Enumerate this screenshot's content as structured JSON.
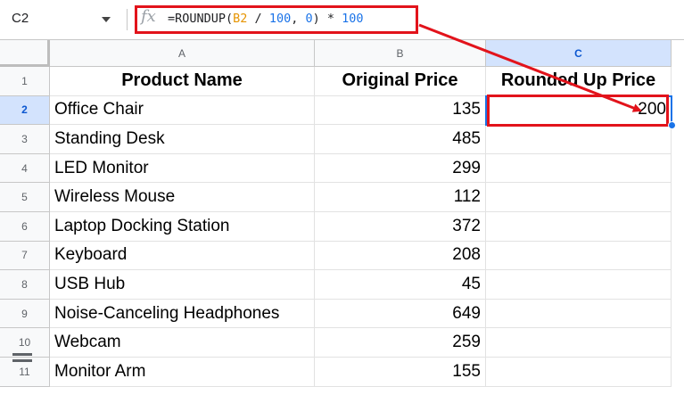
{
  "formula_bar": {
    "name_box": "C2",
    "fx_icon": "fx-icon",
    "formula_parts": [
      {
        "text": "=ROUNDUP(",
        "kind": "func"
      },
      {
        "text": "B2",
        "kind": "ref"
      },
      {
        "text": " / ",
        "kind": "func"
      },
      {
        "text": "100",
        "kind": "num"
      },
      {
        "text": ", ",
        "kind": "func"
      },
      {
        "text": "0",
        "kind": "num"
      },
      {
        "text": ") * ",
        "kind": "func"
      },
      {
        "text": "100",
        "kind": "num"
      }
    ]
  },
  "columns": [
    "A",
    "B",
    "C"
  ],
  "rows": [
    "1",
    "2",
    "3",
    "4",
    "5",
    "6",
    "7",
    "8",
    "9",
    "10",
    "11"
  ],
  "headers": {
    "a": "Product Name",
    "b": "Original Price",
    "c": "Rounded Up Price"
  },
  "table": [
    {
      "product": "Office Chair",
      "price": "135",
      "rounded": "200"
    },
    {
      "product": "Standing Desk",
      "price": "485",
      "rounded": ""
    },
    {
      "product": "LED Monitor",
      "price": "299",
      "rounded": ""
    },
    {
      "product": "Wireless Mouse",
      "price": "112",
      "rounded": ""
    },
    {
      "product": "Laptop Docking Station",
      "price": "372",
      "rounded": ""
    },
    {
      "product": "Keyboard",
      "price": "208",
      "rounded": ""
    },
    {
      "product": "USB Hub",
      "price": "45",
      "rounded": ""
    },
    {
      "product": "Noise-Canceling Headphones",
      "price": "649",
      "rounded": ""
    },
    {
      "product": "Webcam",
      "price": "259",
      "rounded": ""
    },
    {
      "product": "Monitor Arm",
      "price": "155",
      "rounded": ""
    }
  ],
  "selected_cell": "C2",
  "colors": {
    "highlight": "#e2131b",
    "selection": "#1a73e8",
    "cell_ref": "#e69400",
    "number": "#1a73e8"
  }
}
